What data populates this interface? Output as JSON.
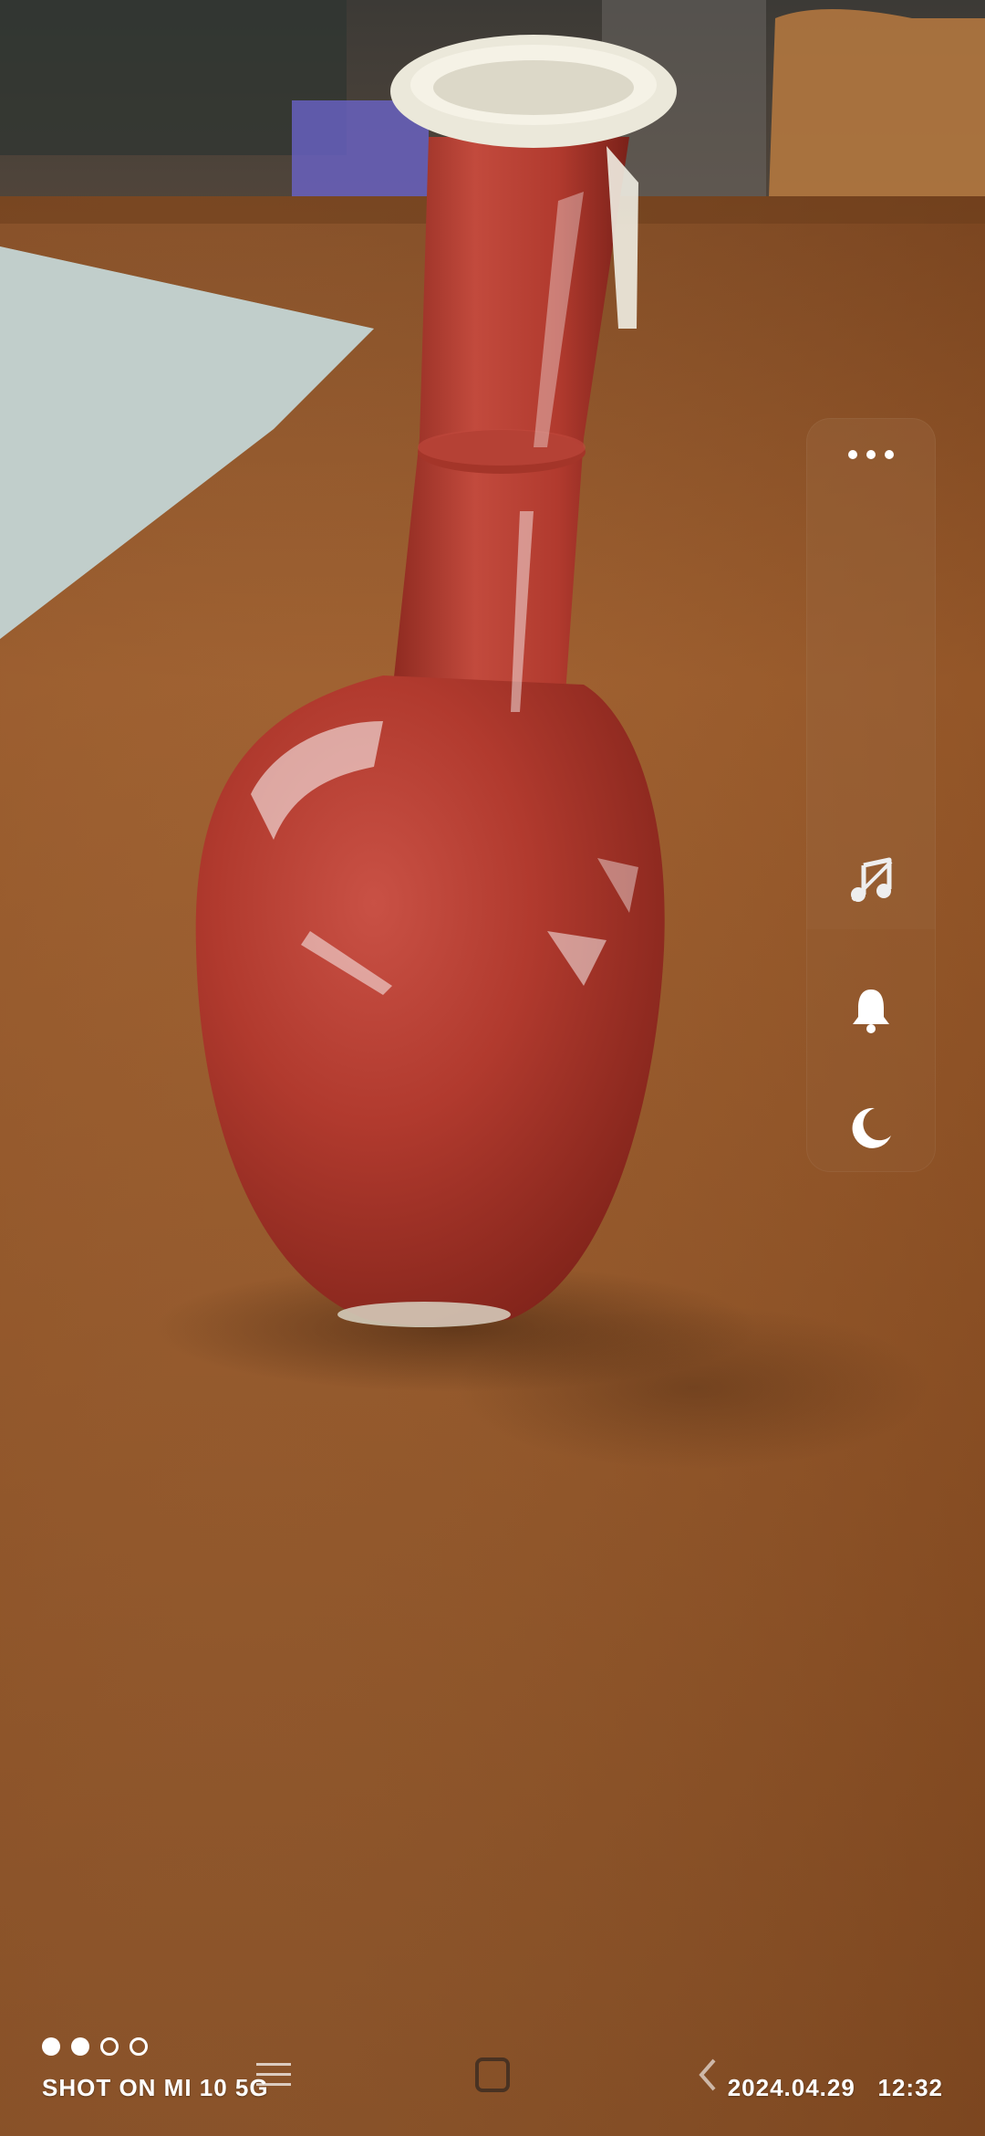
{
  "photo": {
    "subject": "red-glaze-porcelain-vase",
    "colors": {
      "table": "#8a4f22",
      "vase": "#b53a2e",
      "vase_rim": "#efece0"
    }
  },
  "side_panel": {
    "more_icon": "more-dots-icon",
    "music_icon": "music-off-icon",
    "bell_icon": "bell-icon",
    "moon_icon": "moon-icon"
  },
  "watermark": {
    "page_dots": {
      "total": 4,
      "filled": 2
    },
    "text": "SHOT ON MI 10 5G",
    "date": "2024.04.29",
    "time": "12:32"
  },
  "nav_bar": {
    "menu_icon": "menu-icon",
    "home_icon": "home-square-icon",
    "back_icon": "back-chevron-icon"
  }
}
